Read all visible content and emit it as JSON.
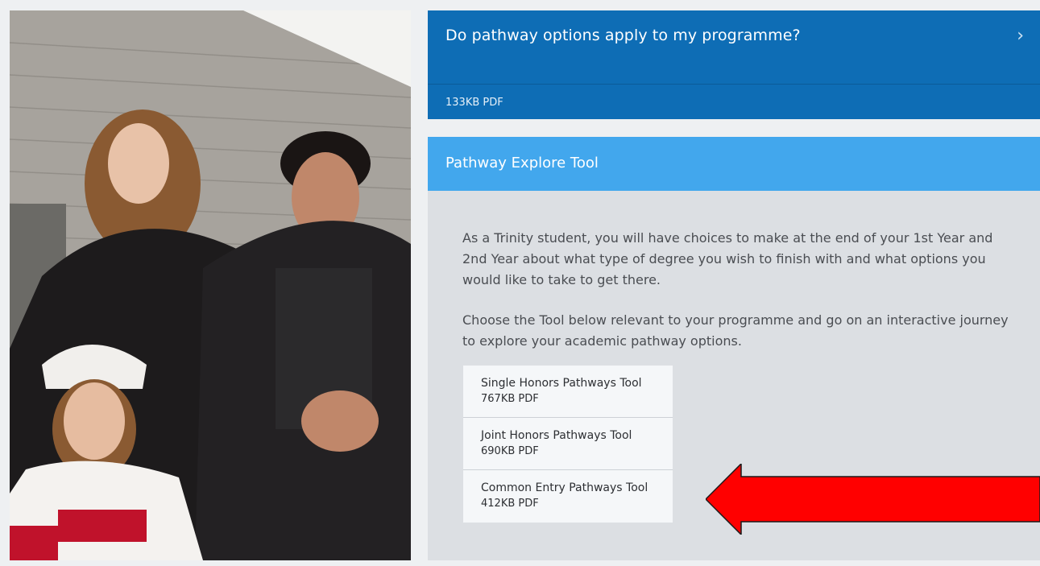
{
  "pathway_card": {
    "question": "Do pathway options apply to my programme?",
    "chevron_glyph": "›",
    "file_size": "133KB PDF"
  },
  "explore_tool": {
    "title": "Pathway Explore Tool",
    "paragraph1": "As a Trinity student, you will have choices to make at the end of your 1st Year and 2nd Year about what type of degree you wish to finish with and what options you would like to take to get there.",
    "paragraph2": "Choose the Tool below relevant to your programme and go on an interactive journey to explore your academic pathway options.",
    "tools": [
      {
        "name": "Single Honors Pathways Tool",
        "size": "767KB PDF"
      },
      {
        "name": "Joint Honors Pathways Tool",
        "size": "690KB PDF"
      },
      {
        "name": "Common Entry Pathways Tool",
        "size": "412KB PDF"
      }
    ]
  },
  "colors": {
    "pathway_blue": "#0e6db5",
    "tool_header_blue": "#42a7ed",
    "panel_grey": "#dcdfe3",
    "annotation_red": "#ff0000"
  },
  "annotation": {
    "arrow_icon": "red-arrow-left"
  }
}
